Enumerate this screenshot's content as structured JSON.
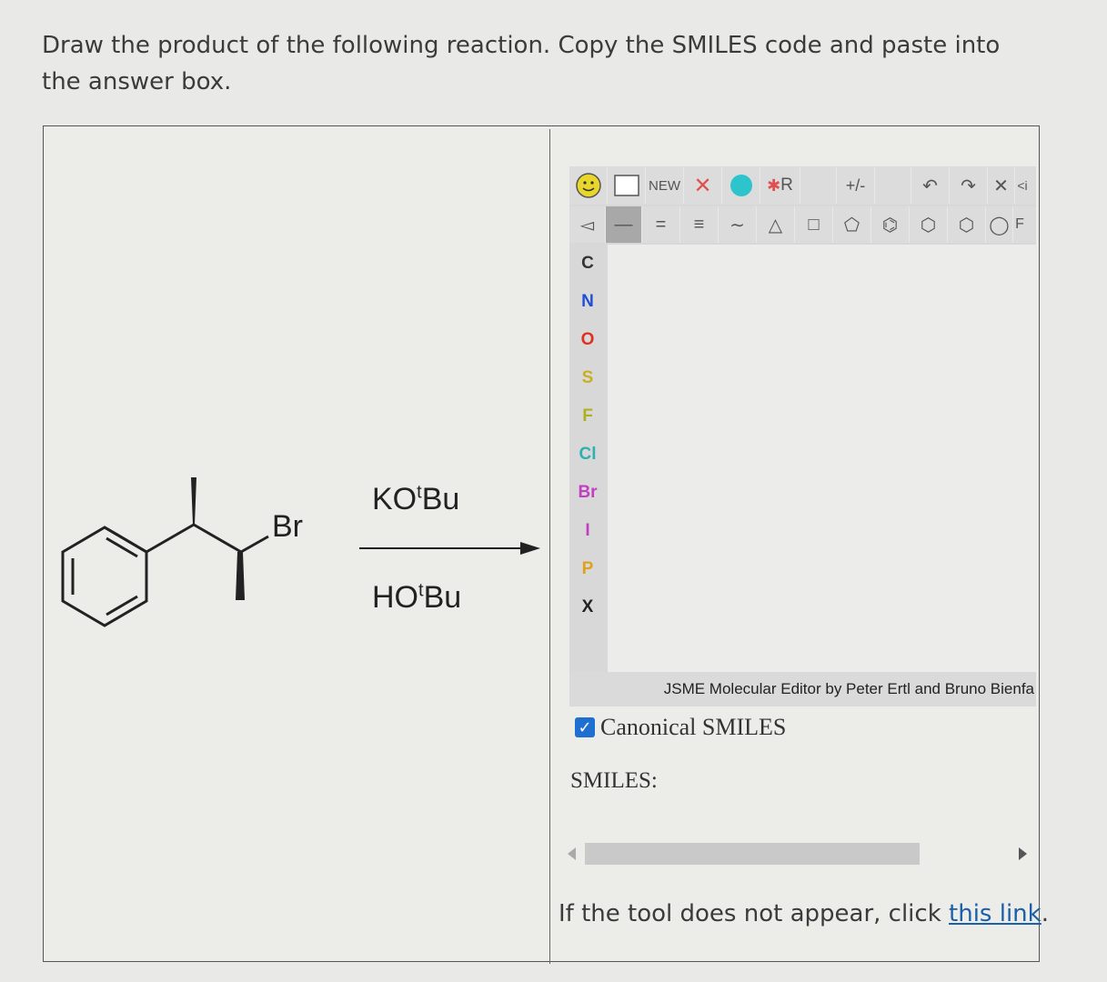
{
  "question": {
    "text": "Draw the product of the following reaction. Copy the SMILES code and paste into the answer box."
  },
  "reaction": {
    "substituent": "Br",
    "reagent_top_prefix": "KO",
    "reagent_top_sup": "t",
    "reagent_top_suffix": "Bu",
    "reagent_bottom_prefix": "HO",
    "reagent_bottom_sup": "t",
    "reagent_bottom_suffix": "Bu"
  },
  "jsme": {
    "toolbar_top": {
      "new_label": "NEW",
      "r_group_label": "R",
      "charge_label": "+/-",
      "clip_label": "<i"
    },
    "toolbar_second": {
      "label_f": "F"
    },
    "atoms": [
      {
        "symbol": "C",
        "color": "#333333"
      },
      {
        "symbol": "N",
        "color": "#1f4fd8"
      },
      {
        "symbol": "O",
        "color": "#e03020"
      },
      {
        "symbol": "S",
        "color": "#c8b020"
      },
      {
        "symbol": "F",
        "color": "#b0b020"
      },
      {
        "symbol": "Cl",
        "color": "#30b0b0"
      },
      {
        "symbol": "Br",
        "color": "#c040c0"
      },
      {
        "symbol": "I",
        "color": "#c040c0"
      },
      {
        "symbol": "P",
        "color": "#e0a020"
      },
      {
        "symbol": "X",
        "color": "#222222"
      }
    ],
    "credit": "JSME Molecular Editor by Peter Ertl and Bruno Bienfa"
  },
  "options": {
    "canonical_smiles_label": "Canonical SMILES",
    "canonical_checked": "✓"
  },
  "smiles": {
    "label": "SMILES:"
  },
  "footer": {
    "prefix": "If the tool does not appear, click ",
    "link_text": "this link",
    "suffix": "."
  },
  "colors": {
    "link": "#1a5fa8",
    "checkbox": "#1f6fd1",
    "smiley": "#e8d62a",
    "circle_tool": "#2ec4cc"
  }
}
